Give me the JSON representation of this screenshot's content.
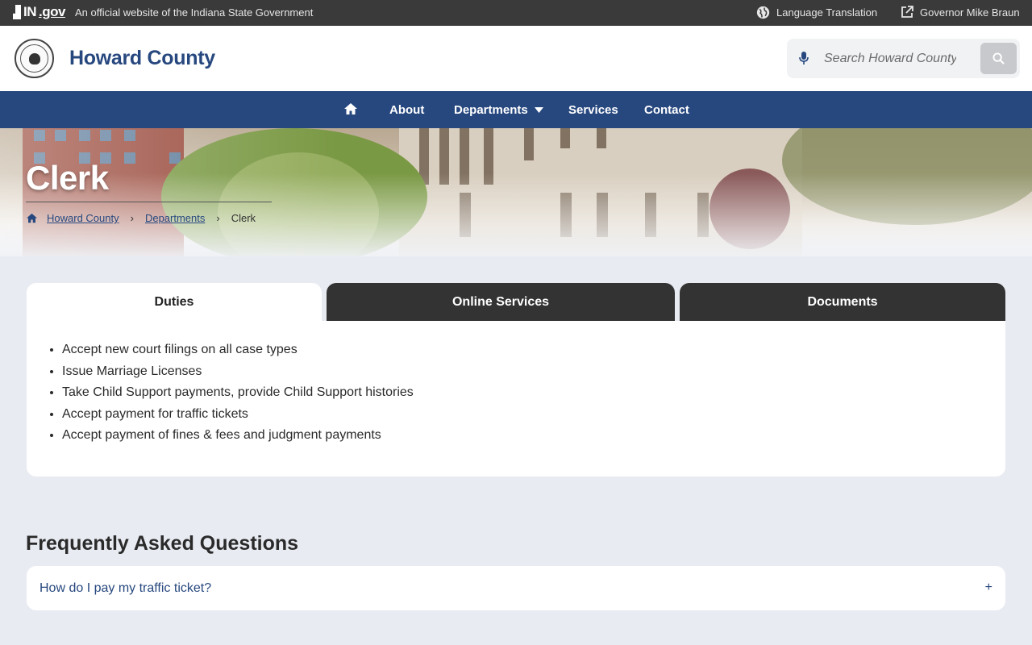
{
  "gov_bar": {
    "logo_text": "IN",
    "logo_suffix": ".gov",
    "official_text": "An official website of the Indiana State Government",
    "language_label": "Language Translation",
    "governor_label": "Governor Mike Braun"
  },
  "header": {
    "site_title": "Howard County",
    "search_placeholder": "Search Howard County"
  },
  "nav": {
    "items": [
      {
        "label": "About"
      },
      {
        "label": "Departments"
      },
      {
        "label": "Services"
      },
      {
        "label": "Contact"
      }
    ]
  },
  "hero": {
    "title": "Clerk",
    "breadcrumb": [
      "Howard County",
      "Departments",
      "Clerk"
    ]
  },
  "tabs": [
    {
      "label": "Duties"
    },
    {
      "label": "Online Services"
    },
    {
      "label": "Documents"
    }
  ],
  "duties": [
    "Accept new court filings on all case types",
    "Issue Marriage Licenses",
    "Take Child Support payments, provide Child Support histories",
    "Accept payment for traffic tickets",
    "Accept payment of fines & fees and judgment payments"
  ],
  "faq": {
    "title": "Frequently Asked Questions",
    "items": [
      {
        "question": "How do I pay my traffic ticket?",
        "toggle": "+"
      }
    ]
  },
  "colors": {
    "brand_blue": "#27487f",
    "gov_bar": "#3a3a3a",
    "tab_dark": "#333333",
    "page_bg": "#e8ebf2"
  }
}
